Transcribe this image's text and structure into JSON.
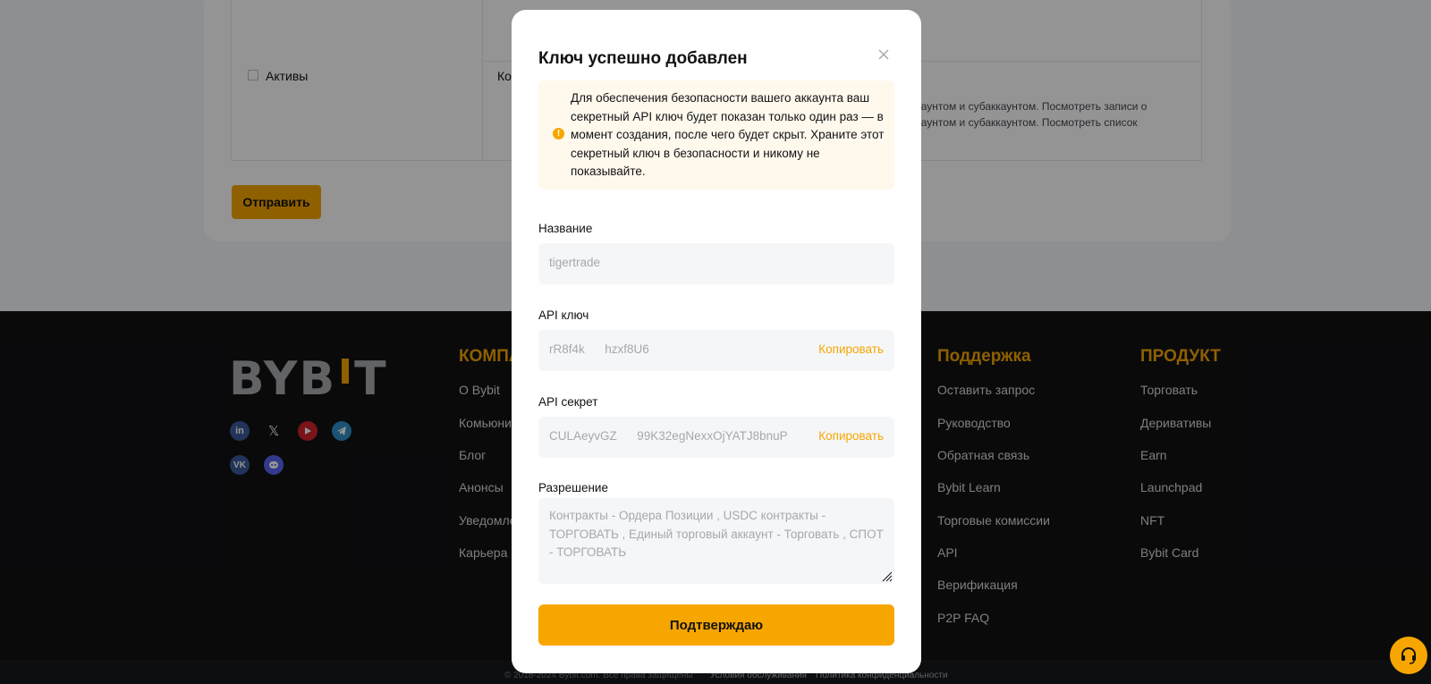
{
  "background": {
    "permission_label": "Активы",
    "permission_label2": "Ко",
    "permission_desc_line1": "ккаунтом и субаккаунтом. Посмотреть записи о",
    "permission_desc_line2": "ккаунтом и субаккаунтом. Посмотреть список",
    "submit_label": "Отправить"
  },
  "footer": {
    "logo_text_left": "BYB",
    "logo_text_right": "T",
    "columns": [
      {
        "title": "КОМПА",
        "links": [
          "О Bybit",
          "Комьюни",
          "Блог",
          "Анонсы",
          "Уведомле",
          "Карьера"
        ]
      },
      {
        "title": "Поддержка",
        "links": [
          "Оставить запрос",
          "Руководство",
          "Обратная связь",
          "Bybit Learn",
          "Торговые комиссии",
          "API",
          "Верификация",
          "P2P FAQ"
        ]
      },
      {
        "title": "ПРОДУКТ",
        "links": [
          "Торговать",
          "Деривативы",
          "Earn",
          "Launchpad",
          "NFT",
          "Bybit Card"
        ]
      }
    ],
    "social_icons": [
      "linkedin-icon",
      "x-icon",
      "youtube-icon",
      "telegram-icon",
      "vk-icon",
      "discord-icon"
    ],
    "copyright": "© 2018-2024 Bybit.com. Все права защищены",
    "terms": "Условия обслуживания",
    "privacy": "Политика конфиденциальности"
  },
  "modal": {
    "title": "Ключ успешно добавлен",
    "alert_text": "Для обеспечения безопасности вашего аккаунта ваш секретный API ключ будет показан только один раз — в момент создания, после чего будет скрыт. Храните этот секретный ключ в безопасности и никому не показывайте.",
    "name_label": "Название",
    "name_value": "tigertrade",
    "api_key_label": "API ключ",
    "api_key_value": "rR8f4k      hzxf8U6",
    "api_secret_label": "API секрет",
    "api_secret_value": "CULAeyvGZ      99K32egNexxOjYATJ8bnuP",
    "copy_label": "Копировать",
    "permission_label": "Разрешение",
    "permission_value": "Контракты - Ордера Позиции  , USDC контракты - ТОРГОВАТЬ  , Единый торговый аккаунт - Торговать  , СПОТ - ТОРГОВАТЬ",
    "confirm_label": "Подтверждаю"
  },
  "colors": {
    "accent": "#f7a600",
    "footer_bg": "#121214",
    "alert_bg": "#fff9ed"
  }
}
